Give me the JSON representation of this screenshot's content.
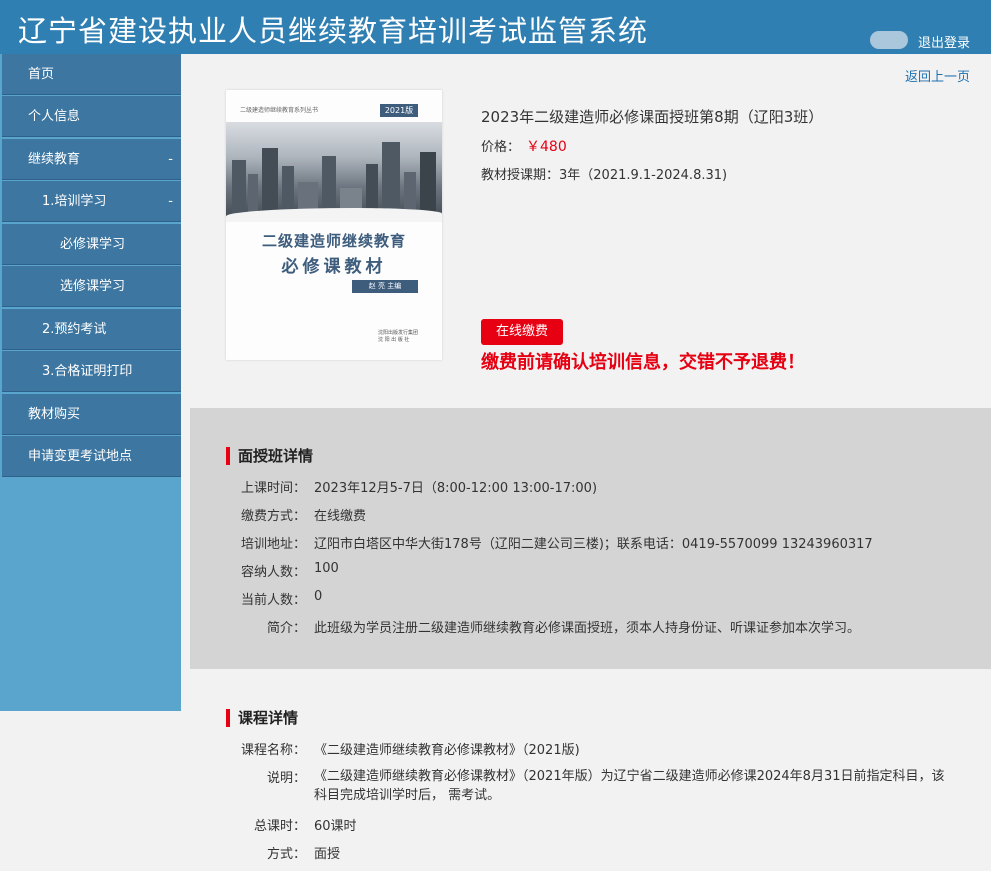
{
  "header": {
    "title": "辽宁省建设执业人员继续教育培训考试监管系统",
    "logout": "退出登录"
  },
  "sidebar": {
    "items": [
      {
        "label": "首页",
        "suffix": ""
      },
      {
        "label": "个人信息",
        "suffix": ""
      },
      {
        "label": "继续教育",
        "suffix": "-"
      },
      {
        "label": "1.培训学习",
        "suffix": "-"
      },
      {
        "label": "必修课学习",
        "suffix": ""
      },
      {
        "label": "选修课学习",
        "suffix": ""
      },
      {
        "label": "2.预约考试",
        "suffix": ""
      },
      {
        "label": "3.合格证明打印",
        "suffix": ""
      },
      {
        "label": "教材购买",
        "suffix": ""
      },
      {
        "label": "申请变更考试地点",
        "suffix": ""
      }
    ]
  },
  "back_link": "返回上一页",
  "book": {
    "series": "二级建造师继续教育系列丛书",
    "edition": "2021版",
    "title_line1": "二级建造师继续教育",
    "title_line2": "必修课教材",
    "author": "赵 亮 主编",
    "publisher_line1": "沈阳出版发行集团",
    "publisher_line2": "沈 阳 出 版 社"
  },
  "course": {
    "name": "2023年二级建造师必修课面授班第8期（辽阳3班）",
    "price_label": "价格：",
    "price_value": "￥480",
    "period": "教材授课期：3年（2021.9.1-2024.8.31)",
    "pay_button": "在线缴费",
    "warning": "缴费前请确认培训信息，交错不予退费！"
  },
  "class_details": {
    "title": "面授班详情",
    "rows": [
      {
        "label": "上课时间：",
        "value": "2023年12月5-7日（8:00-12:00 13:00-17:00)"
      },
      {
        "label": "缴费方式：",
        "value": "在线缴费"
      },
      {
        "label": "培训地址：",
        "value": "辽阳市白塔区中华大街178号（辽阳二建公司三楼)；联系电话：0419-5570099 13243960317"
      },
      {
        "label": "容纳人数：",
        "value": "100"
      },
      {
        "label": "当前人数：",
        "value": "0"
      },
      {
        "label": "简介：",
        "value": "此班级为学员注册二级建造师继续教育必修课面授班，须本人持身份证、听课证参加本次学习。"
      }
    ]
  },
  "course_details": {
    "title": "课程详情",
    "rows": [
      {
        "label": "课程名称：",
        "value": "《二级建造师继续教育必修课教材》（2021版)"
      },
      {
        "label": "说明：",
        "value": "《二级建造师继续教育必修课教材》（2021年版）为辽宁省二级建造师必修课2024年8月31日前指定科目，该科目完成培训学时后， 需考试。"
      },
      {
        "label": "总课时：",
        "value": "60课时"
      },
      {
        "label": "方式：",
        "value": "面授"
      }
    ]
  }
}
